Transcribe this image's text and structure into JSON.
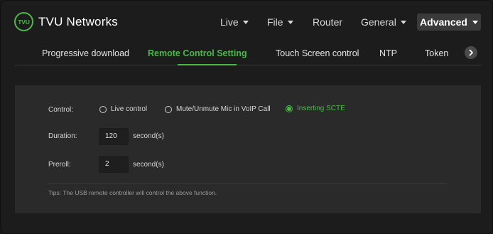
{
  "brand": {
    "badge": "TVU",
    "name": "TVU Networks"
  },
  "nav": {
    "live": "Live",
    "file": "File",
    "router": "Router",
    "general": "General",
    "advanced": "Advanced"
  },
  "tabs": [
    {
      "label": "Progressive download"
    },
    {
      "label": "Remote Control Setting"
    },
    {
      "label": "Touch Screen control"
    },
    {
      "label": "NTP"
    },
    {
      "label": "Token"
    }
  ],
  "form": {
    "control_label": "Control:",
    "options": [
      {
        "label": "Live control",
        "checked": false
      },
      {
        "label": "Mute/Unmute Mic in VoIP Call",
        "checked": false
      },
      {
        "label": "Inserting SCTE",
        "checked": true
      }
    ],
    "duration_label": "Duration:",
    "duration_value": "120",
    "duration_unit": "second(s)",
    "preroll_label": "Preroll:",
    "preroll_value": "2",
    "preroll_unit": "second(s)"
  },
  "tips": "Tips: The USB remote controller will control the above function.",
  "colors": {
    "accent": "#4cb849",
    "background": "#1c1c1c",
    "panel": "#2a2a2a"
  },
  "icons": {
    "next": "chevron-right-icon",
    "dropdown": "caret-down-icon"
  }
}
